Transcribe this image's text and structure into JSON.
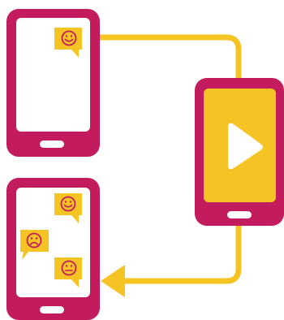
{
  "colors": {
    "phone_body": "#c21c5e",
    "screen_white": "#ffffff",
    "screen_yellow": "#f5c324",
    "connector": "#f5c324",
    "bubble_fill": "#f5c324",
    "face_stroke": "#c21c5e",
    "play_icon": "#ffffff"
  },
  "diagram": {
    "phones": [
      {
        "role": "viewer-phone-top",
        "screen": "white",
        "bubbles": [
          "smile-icon"
        ]
      },
      {
        "role": "video-phone",
        "screen": "yellow",
        "center_icon": "play-icon"
      },
      {
        "role": "viewer-phone-bottom",
        "screen": "white",
        "bubbles": [
          "smile-icon",
          "frown-icon",
          "neutral-face-icon"
        ]
      }
    ],
    "connectors": [
      {
        "from": "viewer-phone-top",
        "to": "video-phone",
        "arrowhead": false
      },
      {
        "from": "video-phone",
        "to": "viewer-phone-bottom",
        "arrowhead": true
      }
    ]
  }
}
